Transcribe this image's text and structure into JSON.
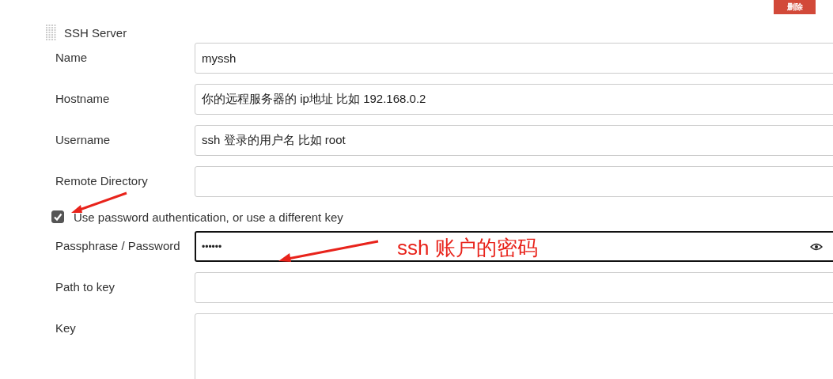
{
  "delete_button": {
    "label": "删除"
  },
  "section": {
    "title": "SSH Server"
  },
  "fields": [
    {
      "kind": "text",
      "label": "Name",
      "value": "myssh"
    },
    {
      "kind": "text",
      "label": "Hostname",
      "value": "你的远程服务器的 ip地址 比如 192.168.0.2"
    },
    {
      "kind": "text",
      "label": "Username",
      "value": "ssh 登录的用户名 比如 root"
    },
    {
      "kind": "text",
      "label": "Remote Directory"
    },
    {
      "kind": "checkbox",
      "label": "Use password authentication, or use a different key",
      "checked": true
    },
    {
      "kind": "password",
      "label": "Passphrase / Password",
      "value": "••••••",
      "focused": true
    },
    {
      "kind": "text",
      "label": "Path to key"
    },
    {
      "kind": "textarea",
      "label": "Key"
    }
  ],
  "annotation": {
    "text": "ssh 账户的密码"
  }
}
